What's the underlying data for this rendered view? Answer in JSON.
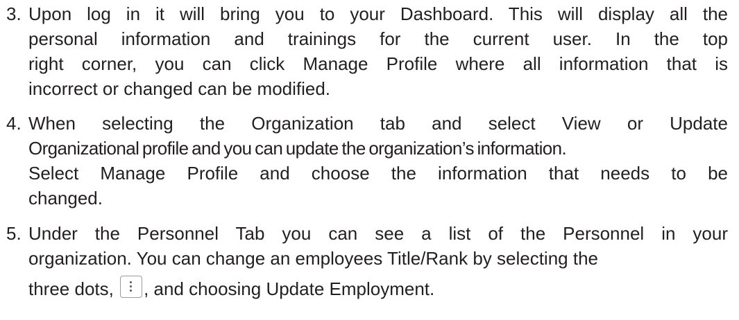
{
  "items": [
    {
      "number": "3.",
      "lines": [
        "Upon log in it will bring you to your Dashboard. This will display all the",
        "personal information and trainings for the current user. In the top",
        "right corner, you can click Manage Profile where all information that is",
        "incorrect or changed can be modified."
      ]
    },
    {
      "number": "4.",
      "lines": [
        "When selecting the Organization tab and select View or Update",
        "Organizational profile and you can update the organization’s information.",
        "Select Manage Profile and choose the information that needs to be",
        "changed."
      ]
    },
    {
      "number": "5.",
      "lines": [
        "Under the Personnel Tab you can see a list of the Personnel in your",
        "organization. You can change an employees Title/Rank by selecting the"
      ],
      "last_line_before": "three dots,",
      "last_line_after": ", and choosing Update Employment.",
      "inline_icon": "more-vertical-icon"
    }
  ]
}
